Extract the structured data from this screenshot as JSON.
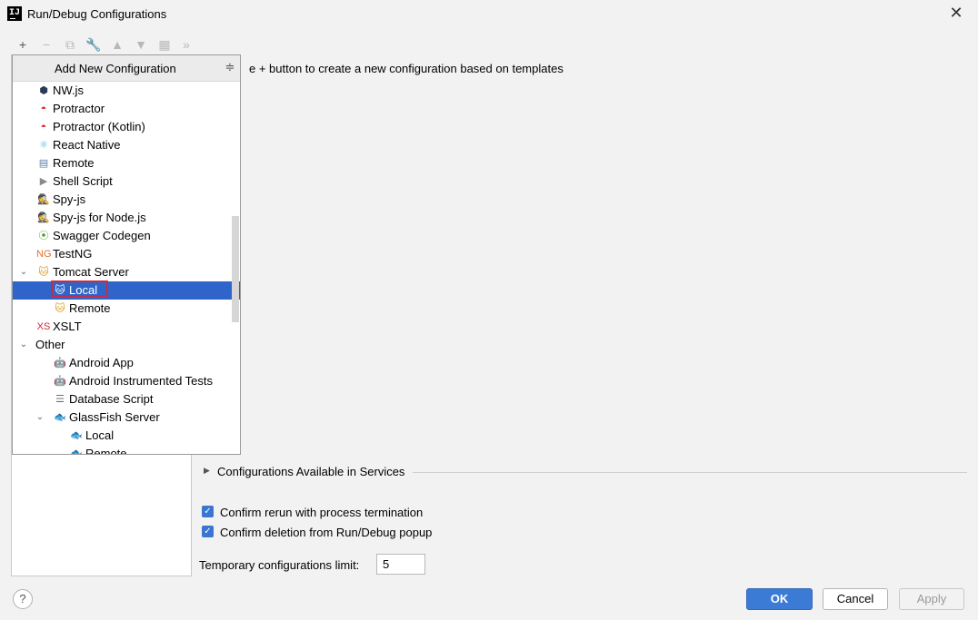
{
  "window": {
    "title": "Run/Debug Configurations",
    "app_icon_text": "IJ",
    "close_glyph": "✕"
  },
  "toolbar": [
    {
      "name": "add-icon",
      "glyph": "+",
      "enabled": true
    },
    {
      "name": "remove-icon",
      "glyph": "−",
      "enabled": false
    },
    {
      "name": "copy-icon",
      "glyph": "⧉",
      "enabled": false
    },
    {
      "name": "wrench-icon",
      "glyph": "🔧",
      "enabled": true
    },
    {
      "name": "move-up-icon",
      "glyph": "▲",
      "enabled": false
    },
    {
      "name": "move-down-icon",
      "glyph": "▼",
      "enabled": false
    },
    {
      "name": "folder-icon",
      "glyph": "▦",
      "enabled": false
    },
    {
      "name": "more-icon",
      "glyph": "»",
      "enabled": false
    }
  ],
  "hint": "e + button to create a new configuration based on templates",
  "popup": {
    "title": "Add New Configuration",
    "collapse_glyph": "≑",
    "items": [
      {
        "label": "NW.js",
        "icon": "nwjs-icon",
        "glyph": "⬢",
        "color": "#2b3a55",
        "level": 1
      },
      {
        "label": "Protractor",
        "icon": "protractor-icon",
        "glyph": "◓",
        "color": "#d6273a",
        "level": 1
      },
      {
        "label": "Protractor (Kotlin)",
        "icon": "protractor-kotlin-icon",
        "glyph": "◓",
        "color": "#d6273a",
        "level": 1
      },
      {
        "label": "React Native",
        "icon": "react-icon",
        "glyph": "⚛",
        "color": "#35b6e0",
        "level": 1
      },
      {
        "label": "Remote",
        "icon": "remote-icon",
        "glyph": "▤",
        "color": "#5a7ea8",
        "level": 1
      },
      {
        "label": "Shell Script",
        "icon": "shell-script-icon",
        "glyph": "▶",
        "color": "#8a8a8a",
        "level": 1
      },
      {
        "label": "Spy-js",
        "icon": "spyjs-icon",
        "glyph": "🕵",
        "color": "#4c8a60",
        "level": 1
      },
      {
        "label": "Spy-js for Node.js",
        "icon": "spyjs-node-icon",
        "glyph": "🕵",
        "color": "#4c8a60",
        "level": 1
      },
      {
        "label": "Swagger Codegen",
        "icon": "swagger-icon",
        "glyph": "⦿",
        "color": "#49a42a",
        "level": 1
      },
      {
        "label": "TestNG",
        "icon": "testng-icon",
        "glyph": "NG",
        "color": "#e07030",
        "level": 1
      },
      {
        "label": "Tomcat Server",
        "icon": "tomcat-icon",
        "glyph": "🐱",
        "color": "#d8a020",
        "level": 1,
        "expanded": true
      },
      {
        "label": "Local",
        "icon": "tomcat-local-icon",
        "glyph": "🐱",
        "color": "#d8a020",
        "level": 2,
        "selected": true
      },
      {
        "label": "Remote",
        "icon": "tomcat-remote-icon",
        "glyph": "🐱",
        "color": "#d8a020",
        "level": 2
      },
      {
        "label": "XSLT",
        "icon": "xslt-icon",
        "glyph": "XS",
        "color": "#d6273a",
        "level": 1
      },
      {
        "label": "Other",
        "icon": "",
        "glyph": "",
        "color": "#000000",
        "level": 0,
        "expanded": true
      },
      {
        "label": "Android App",
        "icon": "android-icon",
        "glyph": "🤖",
        "color": "#3ddc84",
        "level": 2
      },
      {
        "label": "Android Instrumented Tests",
        "icon": "android-tests-icon",
        "glyph": "🤖",
        "color": "#3ddc84",
        "level": 2
      },
      {
        "label": "Database Script",
        "icon": "database-icon",
        "glyph": "☰",
        "color": "#707070",
        "level": 2
      },
      {
        "label": "GlassFish Server",
        "icon": "glassfish-icon",
        "glyph": "🐟",
        "color": "#808080",
        "level": 2,
        "expanded": true
      },
      {
        "label": "Local",
        "icon": "glassfish-local-icon",
        "glyph": "🐟",
        "color": "#808080",
        "level": 3
      },
      {
        "label": "Remote",
        "icon": "glassfish-remote-icon",
        "glyph": "🐟",
        "color": "#808080",
        "level": 3
      }
    ]
  },
  "services": {
    "label": "Configurations Available in Services",
    "chevron": "▶"
  },
  "options": {
    "confirm_rerun": {
      "label": "Confirm rerun with process termination",
      "checked": true
    },
    "confirm_deletion": {
      "label": "Confirm deletion from Run/Debug popup",
      "checked": true
    }
  },
  "temp_limit": {
    "label": "Temporary configurations limit:",
    "value": "5"
  },
  "buttons": {
    "help": "?",
    "ok": "OK",
    "cancel": "Cancel",
    "apply": "Apply"
  },
  "colors": {
    "accent": "#2f65ca",
    "ok_button": "#3b7bd6",
    "highlight_outline": "#d6273a"
  }
}
